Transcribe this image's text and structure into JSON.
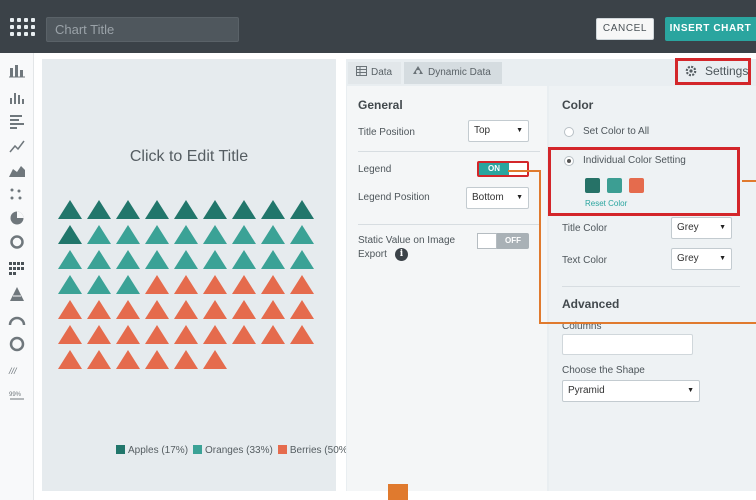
{
  "header": {
    "chart_title_placeholder": "Chart Title",
    "cancel_label": "CANCEL",
    "insert_label": "INSERT CHART"
  },
  "sidebar": {
    "icons": [
      "bar-chart-icon",
      "histogram-icon",
      "horizontal-bar-icon",
      "line-chart-icon",
      "area-chart-icon",
      "scatter-icon",
      "pie-chart-icon",
      "donut-chart-icon",
      "pictograph-icon",
      "pyramid-icon",
      "gauge-icon",
      "radial-icon",
      "sparkline-icon",
      "percent-icon"
    ]
  },
  "preview": {
    "title_prompt": "Click to Edit Title",
    "waffle_rows": [
      [
        "d",
        "d",
        "d",
        "d",
        "d",
        "d",
        "d",
        "d",
        "d"
      ],
      [
        "d",
        "m",
        "m",
        "m",
        "m",
        "m",
        "m",
        "m",
        "m"
      ],
      [
        "m",
        "m",
        "m",
        "m",
        "m",
        "m",
        "m",
        "m",
        "m"
      ],
      [
        "m",
        "m",
        "m",
        "o",
        "o",
        "o",
        "o",
        "o",
        "o"
      ],
      [
        "o",
        "o",
        "o",
        "o",
        "o",
        "o",
        "o",
        "o",
        "o"
      ],
      [
        "o",
        "o",
        "o",
        "o",
        "o",
        "o",
        "o",
        "o",
        "o"
      ],
      [
        "o",
        "o",
        "o",
        "o",
        "o",
        "o"
      ]
    ],
    "legend": [
      {
        "label": "Apples (17%)",
        "color": "#21766b"
      },
      {
        "label": "Oranges (33%)",
        "color": "#3ba296"
      },
      {
        "label": "Berries (50%)",
        "color": "#e56b4d"
      }
    ]
  },
  "tabs": {
    "data": "Data",
    "dynamic": "Dynamic Data",
    "settings": "Settings"
  },
  "general": {
    "heading": "General",
    "title_position_label": "Title Position",
    "title_position_value": "Top",
    "legend_label": "Legend",
    "legend_toggle": "ON",
    "legend_position_label": "Legend Position",
    "legend_position_value": "Bottom",
    "static_value_label_1": "Static Value on Image",
    "static_value_label_2": "Export",
    "static_value_toggle": "OFF"
  },
  "color": {
    "heading": "Color",
    "set_all_label": "Set Color to All",
    "individual_label": "Individual Color Setting",
    "reset_label": "Reset Color",
    "swatches": [
      "#267267",
      "#3c9e93",
      "#e56b4d"
    ],
    "title_color_label": "Title Color",
    "title_color_value": "Grey",
    "text_color_label": "Text Color",
    "text_color_value": "Grey"
  },
  "advanced": {
    "heading": "Advanced",
    "columns_label": "Columns",
    "shape_label": "Choose the Shape",
    "shape_value": "Pyramid"
  },
  "colors": {
    "accent": "#2aa59f",
    "highlight": "#d3262a",
    "annotation": "#e07a2e"
  }
}
